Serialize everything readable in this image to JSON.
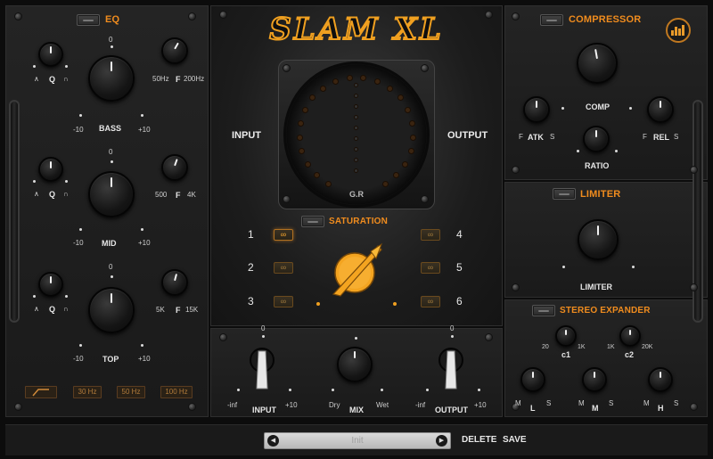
{
  "app": {
    "logo_text": "SLAM XL"
  },
  "eq": {
    "title": "EQ",
    "bands": [
      {
        "name": "BASS",
        "q_label": "Q",
        "f_label": "F",
        "f_low": "50Hz",
        "f_high": "200Hz",
        "gain_min": "-10",
        "gain_max": "+10",
        "gain_center": "0"
      },
      {
        "name": "MID",
        "q_label": "Q",
        "f_label": "F",
        "f_low": "500",
        "f_high": "4K",
        "gain_min": "-10",
        "gain_max": "+10",
        "gain_center": "0"
      },
      {
        "name": "TOP",
        "q_label": "Q",
        "f_label": "F",
        "f_low": "5K",
        "f_high": "15K",
        "gain_min": "-10",
        "gain_max": "+10",
        "gain_center": "0"
      }
    ],
    "hp_filters": [
      "30 Hz",
      "50 Hz",
      "100 Hz"
    ]
  },
  "center": {
    "input_label": "INPUT",
    "output_label": "OUTPUT",
    "gr_label": "G.R",
    "saturation_title": "SATURATION",
    "saturation_modes": [
      "1",
      "2",
      "3",
      "4",
      "5",
      "6"
    ],
    "saturation_active": "1",
    "sat_glyph": "∞"
  },
  "bottom_controls": {
    "input": {
      "label": "INPUT",
      "min": "-inf",
      "max": "+10",
      "center": "0"
    },
    "mix": {
      "label": "MIX",
      "min": "Dry",
      "max": "Wet"
    },
    "output": {
      "label": "OUTPUT",
      "min": "-inf",
      "max": "+10",
      "center": "0"
    }
  },
  "compressor": {
    "title": "COMPRESSOR",
    "comp_label": "COMP",
    "atk_label": "ATK",
    "rel_label": "REL",
    "ratio_label": "RATIO",
    "fast": "F",
    "slow": "S"
  },
  "limiter": {
    "title": "LIMITER",
    "knob_label": "LIMITER"
  },
  "stereo_expander": {
    "title": "STEREO EXPANDER",
    "c1": {
      "label": "c1",
      "min": "20",
      "max": "1K"
    },
    "c2": {
      "label": "c2",
      "min": "1K",
      "max": "20K"
    },
    "bands": [
      {
        "label": "L",
        "min": "M",
        "max": "S"
      },
      {
        "label": "M",
        "min": "M",
        "max": "S"
      },
      {
        "label": "H",
        "min": "M",
        "max": "S"
      }
    ]
  },
  "preset_bar": {
    "preset_name": "Init",
    "delete_label": "DELETE",
    "save_label": "SAVE",
    "prev_glyph": "◀",
    "next_glyph": "▶"
  },
  "colors": {
    "accent": "#f08c1e",
    "led_off": "#3a2410"
  },
  "icons": {
    "brand": "brand-logo-icon",
    "hp_filter": "highpass-filter-icon",
    "q_low": "q-narrow-icon",
    "q_high": "q-wide-icon"
  }
}
